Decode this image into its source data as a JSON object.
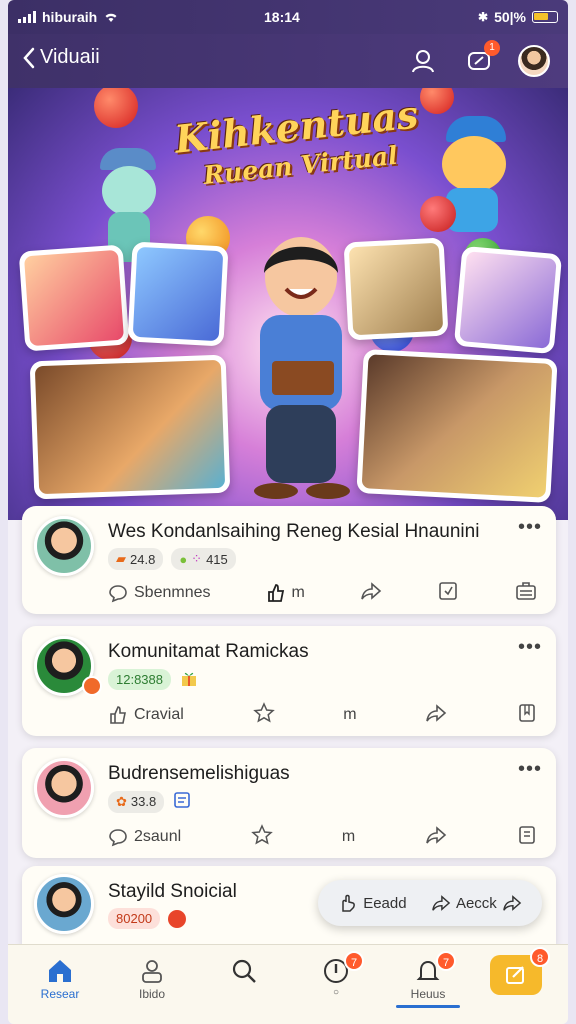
{
  "status": {
    "carrier": "hiburaih",
    "time": "18:14",
    "battery": "50|%"
  },
  "nav": {
    "back_label": "Viduaii",
    "message_badge": "1"
  },
  "hero": {
    "title_line1": "Kihkentuas",
    "title_line2": "Ruean Virtual"
  },
  "posts": [
    {
      "title": "Wes Kondanlsaihing Reneg Kesial Hnaunini",
      "stat1": "24.8",
      "stat2": "415",
      "comment_label": "Sbenmnes",
      "like_label": "m"
    },
    {
      "title": "Komunitamat Ramickas",
      "stat1": "12:8388",
      "comment_label": "Cravial",
      "like_label": "m"
    },
    {
      "title": "Budrensemelishiguas",
      "stat1": "33.8",
      "comment_label": "2saunl",
      "like_label": "m"
    },
    {
      "title": "Stayild Snoicial",
      "stat1": "80200"
    }
  ],
  "floater": {
    "read_label": "Eeadd",
    "back_label": "Aecck"
  },
  "tabs": [
    {
      "label": "Resear"
    },
    {
      "label": "Ibido"
    },
    {
      "label": ""
    },
    {
      "label": "",
      "badge": "7"
    },
    {
      "label": "Heuus",
      "badge": "7"
    },
    {
      "label": "",
      "badge": "8"
    }
  ]
}
